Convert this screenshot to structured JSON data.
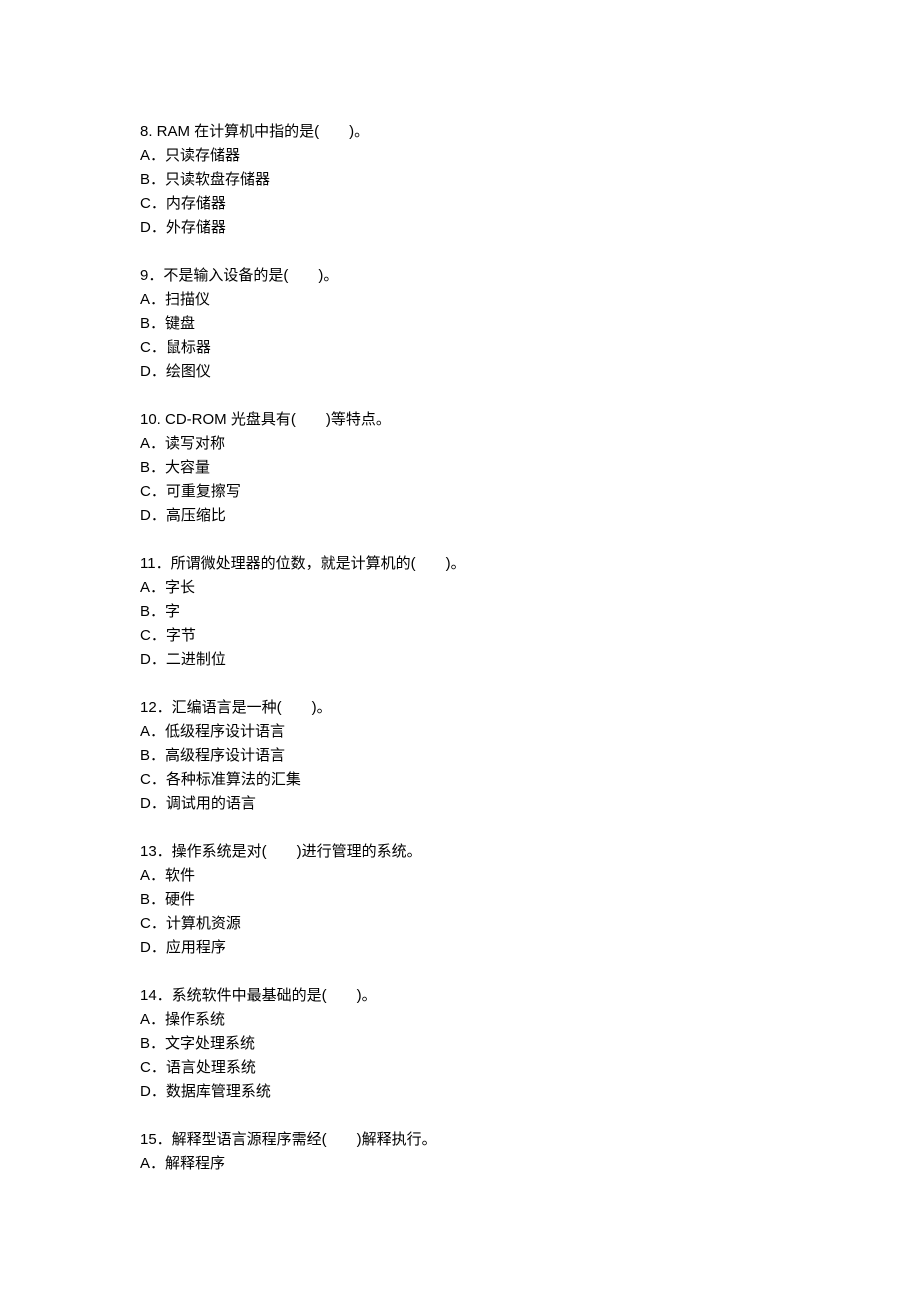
{
  "questions": [
    {
      "stem": "8. RAM 在计算机中指的是(　　)。",
      "options": {
        "A": "A．只读存储器",
        "B": "B．只读软盘存储器",
        "C": "C．内存储器",
        "D": "D．外存储器"
      }
    },
    {
      "stem": "9．不是输入设备的是(　　)。",
      "options": {
        "A": "A．扫描仪",
        "B": "B．键盘",
        "C": "C．鼠标器",
        "D": "D．绘图仪"
      }
    },
    {
      "stem": "10. CD-ROM 光盘具有(　　)等特点。",
      "options": {
        "A": "A．读写对称",
        "B": "B．大容量",
        "C": "C．可重复擦写",
        "D": "D．高压缩比"
      }
    },
    {
      "stem": "11．所谓微处理器的位数，就是计算机的(　　)。",
      "options": {
        "A": "A．字长",
        "B": "B．字",
        "C": "C．字节",
        "D": "D．二进制位"
      }
    },
    {
      "stem": "12．汇编语言是一种(　　)。",
      "options": {
        "A": "A．低级程序设计语言",
        "B": "B．高级程序设计语言",
        "C": "C．各种标准算法的汇集",
        "D": "D．调试用的语言"
      }
    },
    {
      "stem": "13．操作系统是对(　　)进行管理的系统。",
      "options": {
        "A": "A．软件",
        "B": "B．硬件",
        "C": "C．计算机资源",
        "D": "D．应用程序"
      }
    },
    {
      "stem": "14．系统软件中最基础的是(　　)。",
      "options": {
        "A": "A．操作系统",
        "B": "B．文字处理系统",
        "C": "C．语言处理系统",
        "D": "D．数据库管理系统"
      }
    },
    {
      "stem": "15．解释型语言源程序需经(　　)解释执行。",
      "options": {
        "A": "A．解释程序"
      }
    }
  ]
}
